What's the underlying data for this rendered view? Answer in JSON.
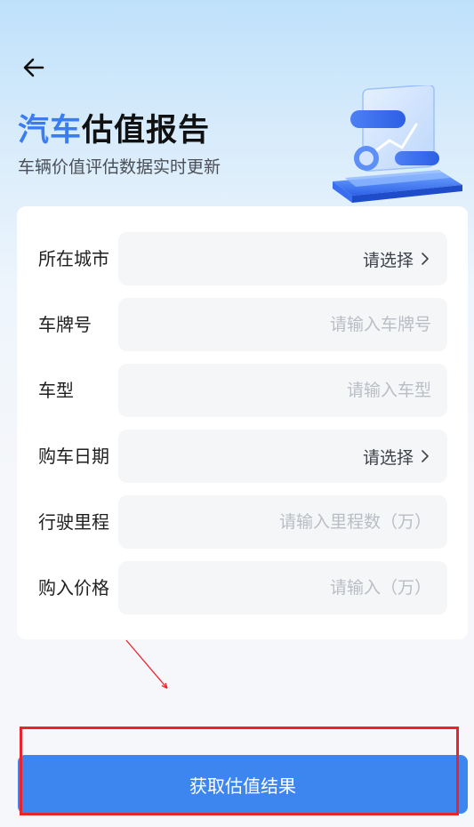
{
  "header": {
    "back_icon": "back-arrow-icon",
    "title_accent": "汽车",
    "title_main": "估值报告",
    "subtitle": "车辆价值评估数据实时更新"
  },
  "form": {
    "rows": [
      {
        "label": "所在城市",
        "type": "select",
        "value": "请选择"
      },
      {
        "label": "车牌号",
        "type": "input",
        "placeholder": "请输入车牌号"
      },
      {
        "label": "车型",
        "type": "input",
        "placeholder": "请输入车型"
      },
      {
        "label": "购车日期",
        "type": "select",
        "value": "请选择"
      },
      {
        "label": "行驶里程",
        "type": "input",
        "placeholder": "请输入里程数（万）"
      },
      {
        "label": "购入价格",
        "type": "input",
        "placeholder": "请输入（万）"
      }
    ]
  },
  "submit": {
    "label": "获取估值结果"
  },
  "colors": {
    "accent": "#3a7df0",
    "button": "#3d85ef",
    "annotation": "#e8252e"
  }
}
